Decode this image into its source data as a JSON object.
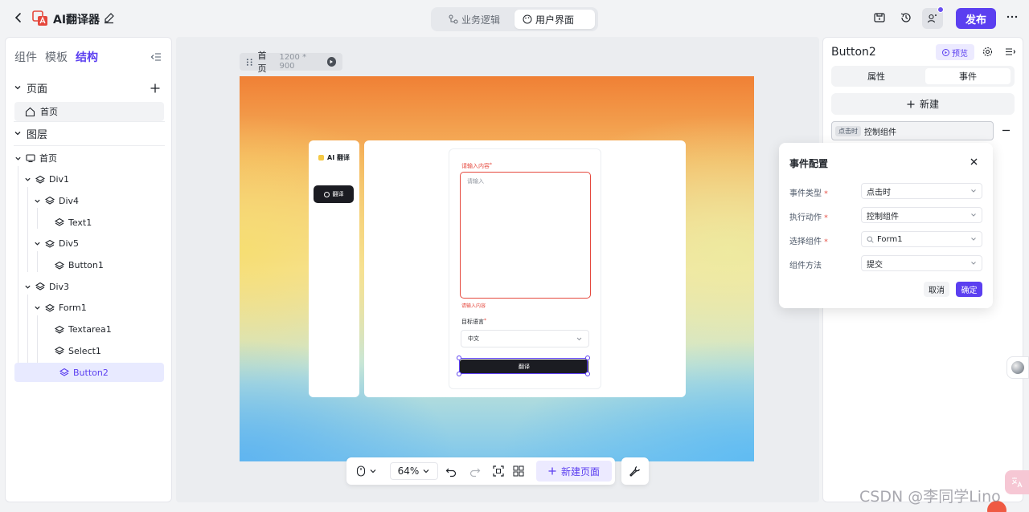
{
  "app": {
    "title": "AI翻译器"
  },
  "mode_tabs": [
    {
      "label": "业务逻辑"
    },
    {
      "label": "用户界面"
    }
  ],
  "publish_label": "发布",
  "left_panel": {
    "tabs": [
      {
        "label": "组件"
      },
      {
        "label": "模板"
      },
      {
        "label": "结构"
      }
    ],
    "pages_title": "页面",
    "page_item": "首页",
    "layers_title": "图层",
    "tree": [
      {
        "label": "首页",
        "depth": 0
      },
      {
        "label": "Div1",
        "depth": 1
      },
      {
        "label": "Div4",
        "depth": 2
      },
      {
        "label": "Text1",
        "depth": 3
      },
      {
        "label": "Div5",
        "depth": 2
      },
      {
        "label": "Button1",
        "depth": 3
      },
      {
        "label": "Div3",
        "depth": 1
      },
      {
        "label": "Form1",
        "depth": 2
      },
      {
        "label": "Textarea1",
        "depth": 3
      },
      {
        "label": "Select1",
        "depth": 3
      },
      {
        "label": "Button2",
        "depth": 3
      }
    ]
  },
  "canvas": {
    "page_name": "首页",
    "page_size": "1200 * 900",
    "preview": {
      "logo_text": "AI 翻译",
      "nav_button": "翻译",
      "content_label": "请输入内容",
      "textarea_placeholder": "请输入",
      "error_text": "请输入内容",
      "lang_label": "目标语言",
      "lang_value": "中文",
      "submit_label": "翻译"
    },
    "zoom": "64%",
    "new_page_label": "新建页面"
  },
  "right_panel": {
    "title": "Button2",
    "preview_label": "预览",
    "tabs": [
      {
        "label": "属性"
      },
      {
        "label": "事件"
      }
    ],
    "new_label": "新建",
    "event_tag": "点击时",
    "event_text": "控制组件"
  },
  "event_config": {
    "title": "事件配置",
    "fields": [
      {
        "label": "事件类型",
        "value": "点击时",
        "required": "*"
      },
      {
        "label": "执行动作",
        "value": "控制组件",
        "required": "*"
      },
      {
        "label": "选择组件",
        "value": "Form1",
        "required": "*"
      },
      {
        "label": "组件方法",
        "value": "提交",
        "required": ""
      }
    ],
    "cancel_label": "取消",
    "ok_label": "确定"
  },
  "watermark": "CSDN @李同学Lino",
  "colors": {
    "accent": "#5b3ff0",
    "error": "#e5483d"
  }
}
